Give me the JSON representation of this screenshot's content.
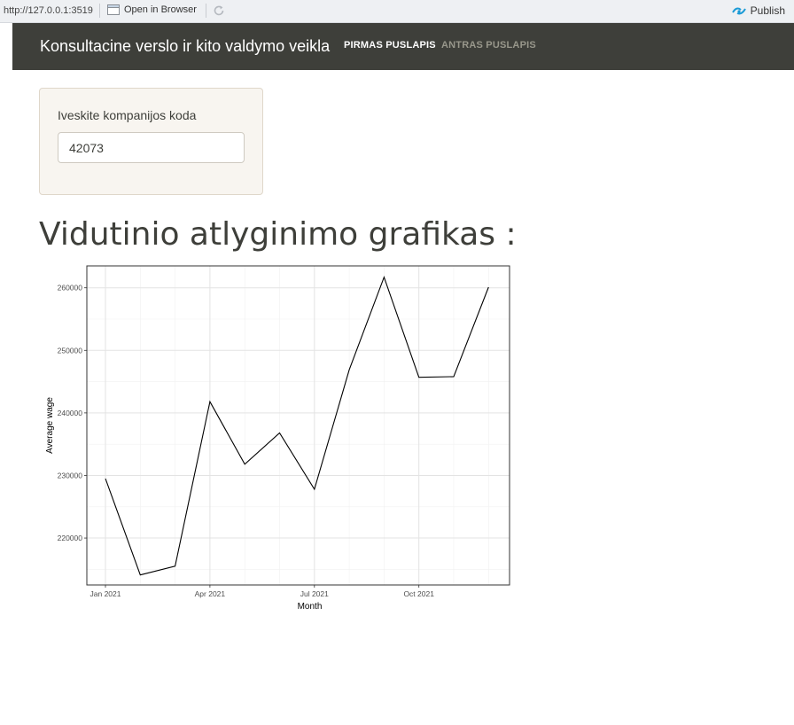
{
  "toolbar": {
    "url": "http://127.0.0.1:3519",
    "open_label": "Open in Browser",
    "publish_label": "Publish",
    "accent": "#1a9ad6"
  },
  "navbar": {
    "brand": "Konsultacine verslo ir kito valdymo veikla",
    "tabs": [
      {
        "label": "PIRMAS PUSLAPIS",
        "active": true
      },
      {
        "label": "ANTRAS PUSLAPIS",
        "active": false
      }
    ]
  },
  "sidebar": {
    "input_label": "Iveskite kompanijos koda",
    "input_value": "42073"
  },
  "main": {
    "title": "Vidutinio atlyginimo grafikas :"
  },
  "chart_data": {
    "type": "line",
    "xlabel": "Month",
    "ylabel": "Average wage",
    "x_tick_labels": [
      "Jan 2021",
      "Apr 2021",
      "Jul 2021",
      "Oct 2021"
    ],
    "y_tick_labels": [
      "220000",
      "230000",
      "240000",
      "250000",
      "260000"
    ],
    "x": [
      "2021-01",
      "2021-02",
      "2021-03",
      "2021-04",
      "2021-05",
      "2021-06",
      "2021-07",
      "2021-08",
      "2021-09",
      "2021-10",
      "2021-11",
      "2021-12"
    ],
    "values": [
      229500,
      214100,
      215500,
      241800,
      231800,
      236800,
      227800,
      246900,
      261700,
      245700,
      245800,
      260100
    ],
    "ylim": [
      212500,
      263500
    ],
    "grid": true,
    "line_color": "#000000"
  }
}
